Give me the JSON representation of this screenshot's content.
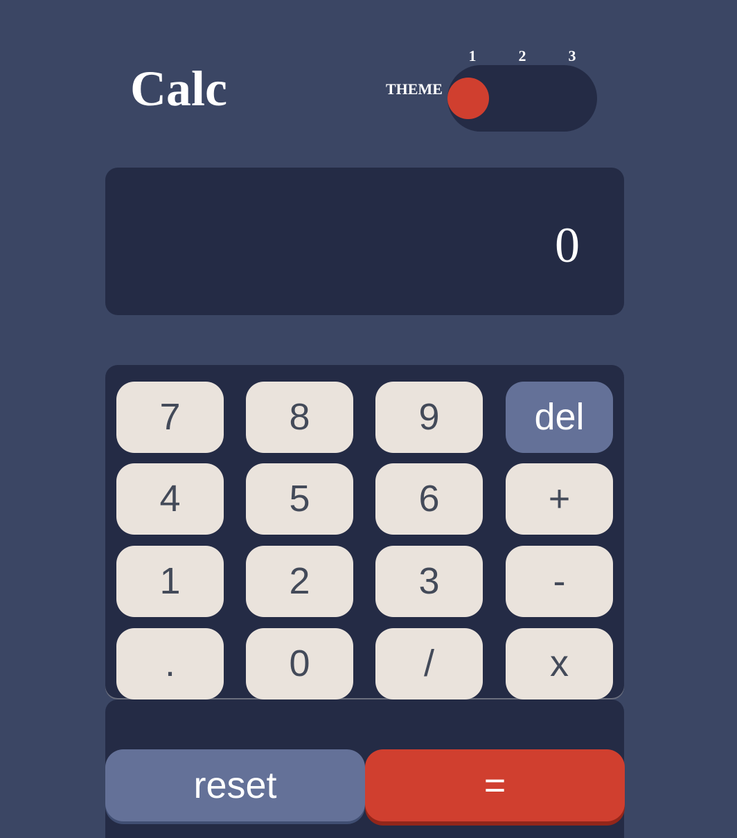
{
  "header": {
    "title": "Calc",
    "theme_label": "THEME",
    "theme_options": [
      "1",
      "2",
      "3"
    ],
    "selected_theme": "1"
  },
  "display": {
    "value": "0"
  },
  "keypad": {
    "keys": [
      "7",
      "8",
      "9",
      "del",
      "4",
      "5",
      "6",
      "+",
      "1",
      "2",
      "3",
      "-",
      ".",
      "0",
      "/",
      "x"
    ],
    "reset_label": "reset",
    "equals_label": "="
  },
  "colors": {
    "background": "#3b4664",
    "panel": "#242b45",
    "key": "#eae3dc",
    "key_text": "#434a59",
    "del_key": "#647198",
    "reset_key": "#647198",
    "accent": "#d03f2f"
  }
}
